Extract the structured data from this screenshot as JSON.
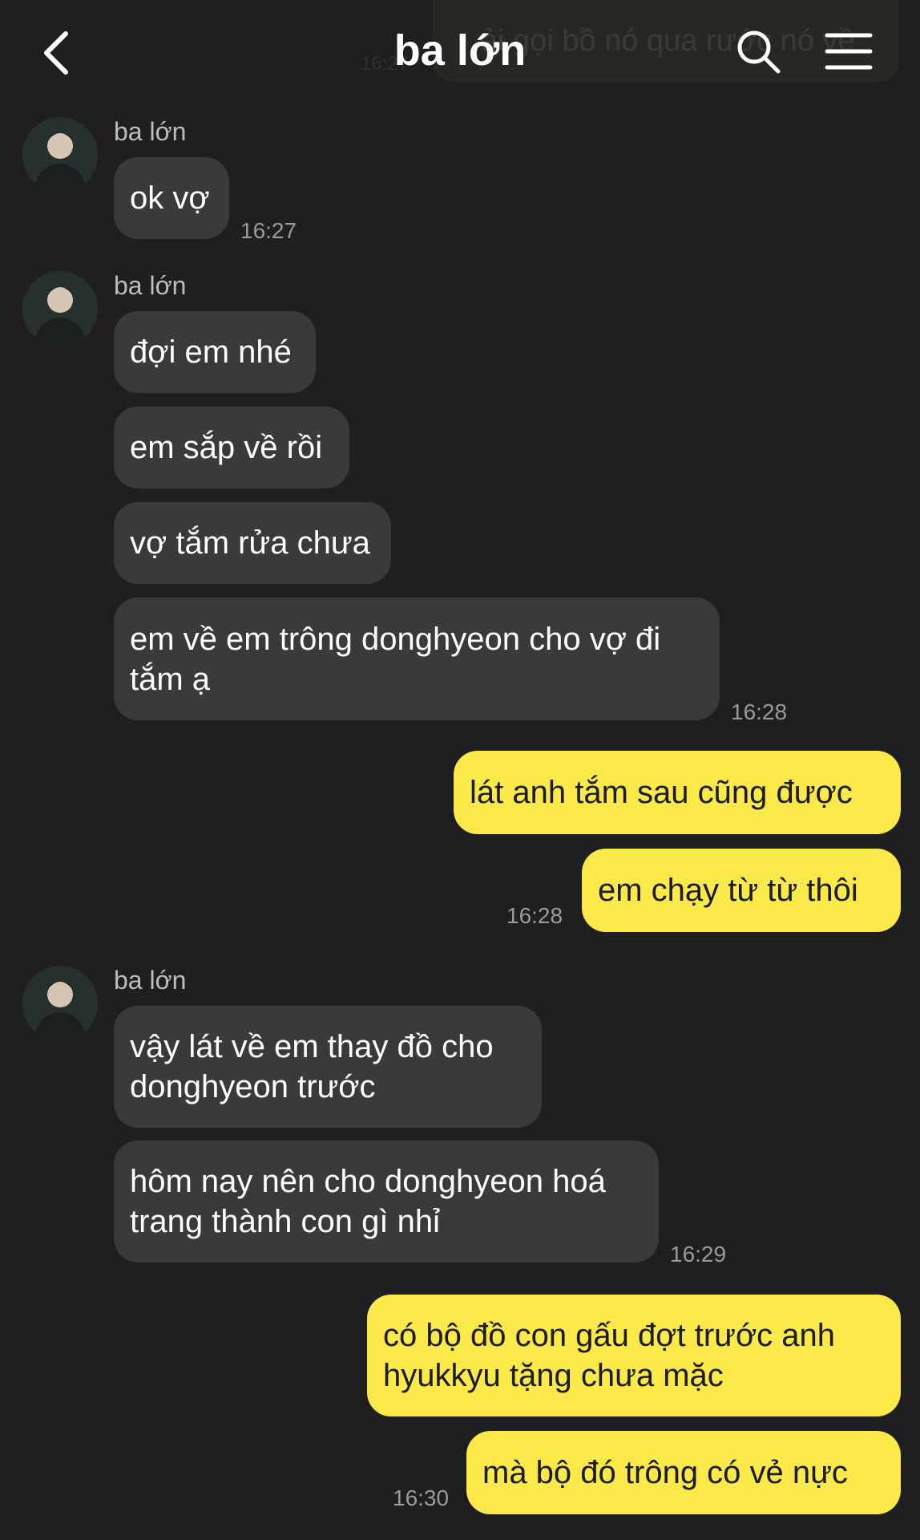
{
  "header": {
    "title": "ba lớn",
    "ghost_preview": "ải gọi bồ nó qua rước nó về",
    "ghost_time": "16:27"
  },
  "colors": {
    "background": "#1f1f21",
    "incoming": "#3a3a3c",
    "outgoing": "#fbe94a"
  },
  "messages": {
    "g1": {
      "sender": "ba lớn",
      "b1": "ok vợ",
      "time": "16:27"
    },
    "g2": {
      "sender": "ba lớn",
      "b1": "đợi em nhé",
      "b2": "em sắp về rồi",
      "b3": "vợ tắm rửa chưa",
      "b4": "em về em trông donghyeon cho vợ đi\ntắm ạ",
      "time": "16:28"
    },
    "o1": {
      "b1": "lát anh tắm sau cũng được",
      "b2": "em chạy từ từ thôi",
      "time": "16:28"
    },
    "g3": {
      "sender": "ba lớn",
      "b1": "vậy lát về em thay đồ cho\ndonghyeon trước",
      "b2": "hôm nay nên cho donghyeon hoá\ntrang thành con gì nhỉ",
      "time": "16:29"
    },
    "o2": {
      "b1": "có bộ đồ con gấu đợt trước anh\nhyukkyu tặng chưa mặc",
      "b2": "mà bộ đó trông có vẻ nực",
      "time": "16:30"
    }
  }
}
